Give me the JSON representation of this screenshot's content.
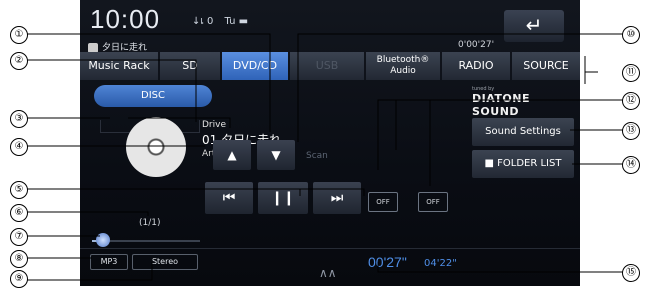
{
  "status": {
    "clock": "10:00",
    "indicator": "↓เ 0",
    "battery": "Tu ▬"
  },
  "now_playing_line": "夕日に走れ",
  "elapsed_top": "0'00'27'",
  "tabs": [
    {
      "label": "Music Rack",
      "state": "normal"
    },
    {
      "label": "SD",
      "state": "normal"
    },
    {
      "label": "DVD/CD",
      "state": "active"
    },
    {
      "label": "USB",
      "state": "disabled"
    },
    {
      "label_line1": "Bluetooth®",
      "label_line2": "Audio",
      "state": "normal"
    },
    {
      "label": "RADIO",
      "state": "normal"
    },
    {
      "label": "SOURCE",
      "state": "normal"
    }
  ],
  "disc_button": "DISC",
  "track": {
    "drive": "Drive",
    "title": "01 夕日に走れ",
    "artist": "Artist01"
  },
  "controls": {
    "up": "▲",
    "down": "▼",
    "scan_line1": "Scan",
    "prev": "⏮",
    "pause": "❙❙",
    "next": "⏭",
    "repeat": "OFF",
    "random": "OFF"
  },
  "brand": {
    "tuned_by": "tuned by",
    "logo": "DIATONE SOUND"
  },
  "side_buttons": {
    "sound_settings": "Sound Settings",
    "folder_list": "■ FOLDER LIST"
  },
  "eq_label": "(1/1)",
  "badges": {
    "format": "MP3",
    "stereo": "Stereo"
  },
  "time": {
    "current": "00'27\"",
    "total": "04'22\""
  },
  "progress_fraction": 0.1,
  "callouts": [
    "①",
    "②",
    "③",
    "④",
    "⑤",
    "⑥",
    "⑦",
    "⑧",
    "⑨",
    "⑩",
    "⑪",
    "⑫",
    "⑬",
    "⑭",
    "⑮"
  ],
  "colors": {
    "accent": "#2f63b8",
    "time_text": "#4f8ee6",
    "background": "#0a0d14"
  }
}
